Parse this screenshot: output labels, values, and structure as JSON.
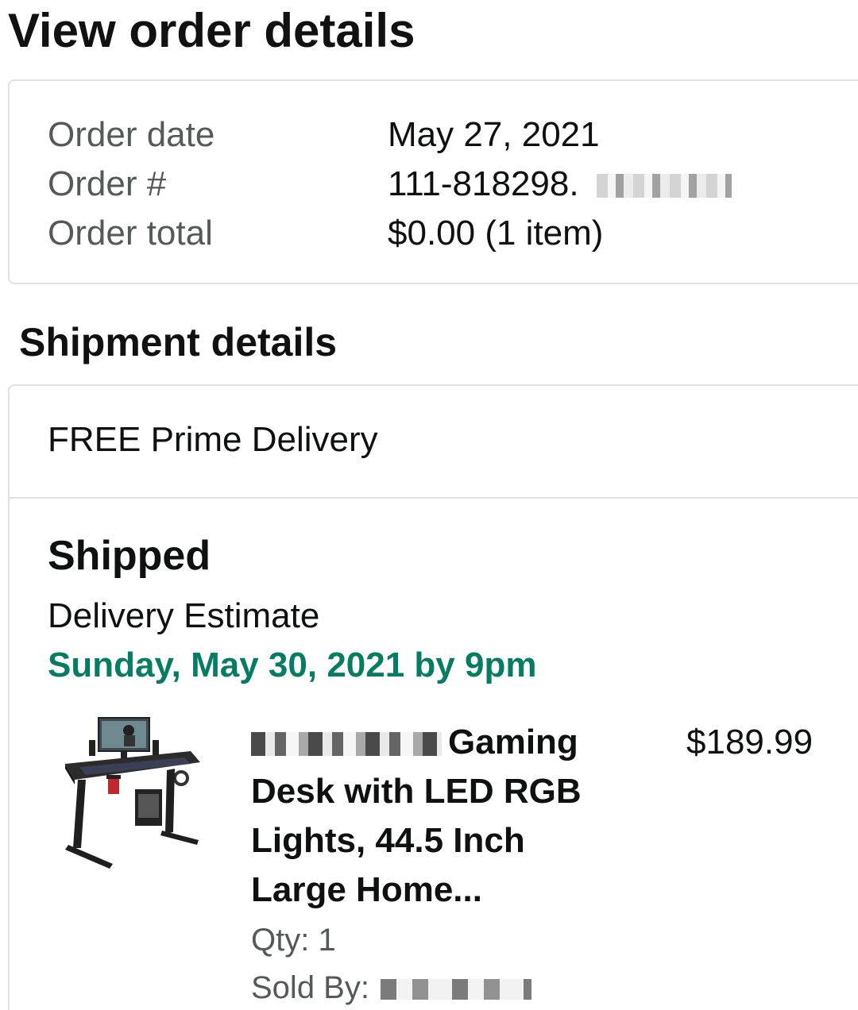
{
  "header": {
    "title": "View order details"
  },
  "order_summary": {
    "rows": [
      {
        "label": "Order date",
        "value": "May 27, 2021"
      },
      {
        "label": "Order #",
        "value": "111-818298."
      },
      {
        "label": "Order total",
        "value": "$0.00 (1 item)"
      }
    ]
  },
  "shipment": {
    "section_title": "Shipment details",
    "method": "FREE Prime Delivery",
    "status": "Shipped",
    "estimate_label": "Delivery Estimate",
    "estimate_date": "Sunday, May 30, 2021 by 9pm",
    "estimate_color": "#067d62",
    "item": {
      "title": "Gaming Desk with LED RGB Lights, 44.5 Inch Large Home...",
      "price": "$189.99",
      "qty": "Qty: 1",
      "sold_by_label": "Sold By:",
      "image_icon": "gaming-desk-product-image"
    }
  }
}
